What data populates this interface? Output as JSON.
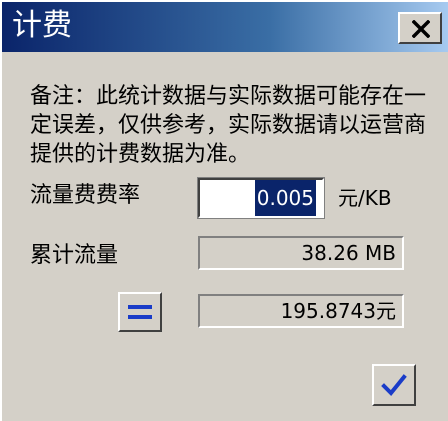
{
  "window": {
    "title": "计费",
    "close_icon": "close-icon"
  },
  "note": {
    "text": "备注：此统计数据与实际数据可能存在一定误差，仅供参考，实际数据请以运营商提供的计费数据为准。"
  },
  "rate": {
    "label": "流量费费率",
    "value": "0.005",
    "unit": "元/KB"
  },
  "total_traffic": {
    "label": "累计流量",
    "value": "38.26 MB"
  },
  "cost": {
    "value": "195.8743元"
  },
  "buttons": {
    "calculate_icon": "equals-icon",
    "confirm_icon": "checkmark-icon"
  },
  "colors": {
    "title_start": "#0a246a",
    "title_end": "#a6caf0",
    "face": "#d4d0c8",
    "icon_blue": "#1a3cc8"
  }
}
